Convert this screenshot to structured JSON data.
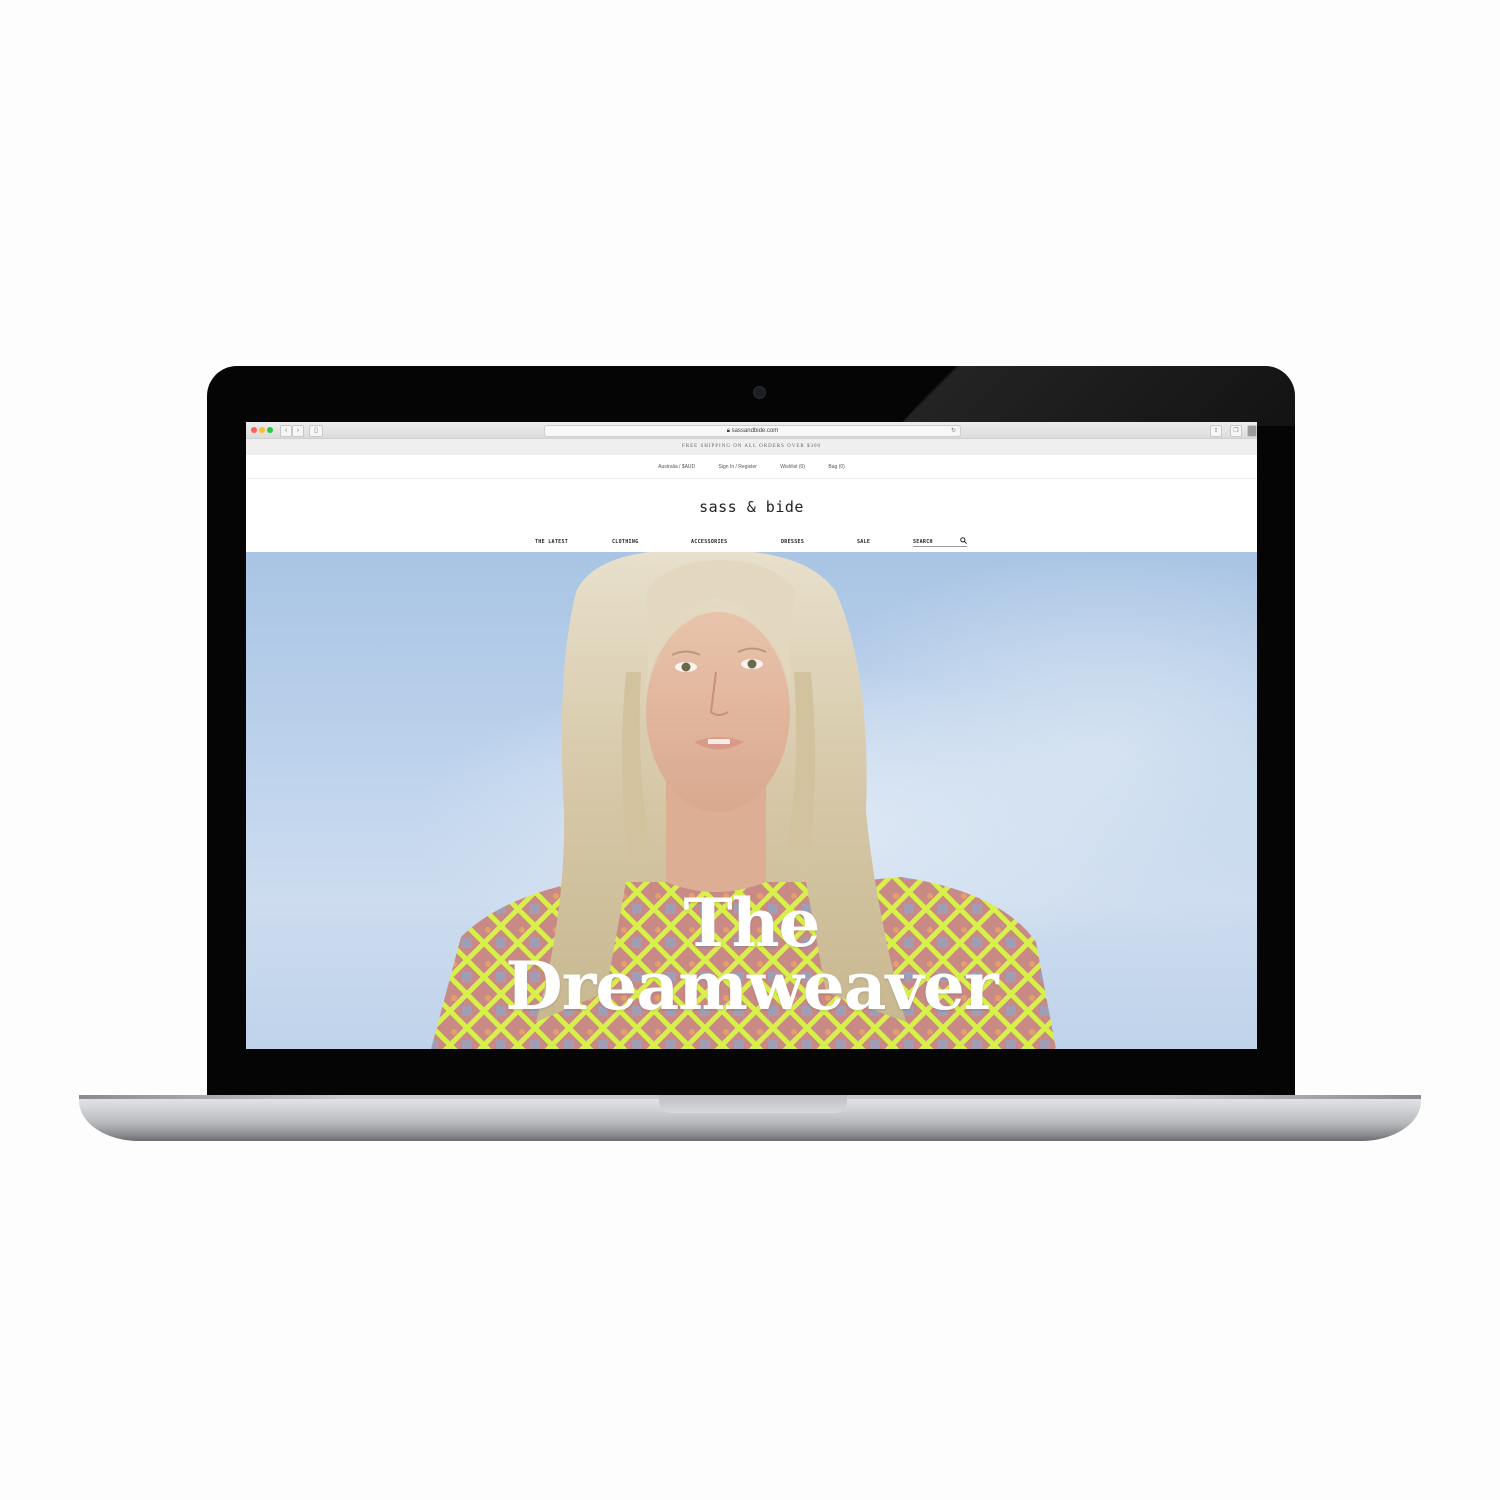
{
  "browser": {
    "url": "sassandbide.com",
    "back_icon": "chevron-left-icon",
    "forward_icon": "chevron-right-icon",
    "sidebar_icon": "sidebar-icon",
    "reload_icon": "reload-icon",
    "share_icon": "share-icon",
    "tabs_icon": "tabs-icon"
  },
  "site": {
    "promo": "FREE SHIPPING ON ALL ORDERS OVER $300",
    "utility": {
      "region": "Australia / $AUD",
      "account": "Sign In / Register",
      "wishlist": "Wishlist (0)",
      "bag": "Bag (0)"
    },
    "logo": "sass & bide",
    "nav": {
      "latest": "THE LATEST",
      "clothing": "CLOTHING",
      "accessories": "ACCESSORIES",
      "dresses": "DRESSES",
      "sale": "SALE",
      "search_label": "SEARCH"
    },
    "hero": {
      "line1": "The",
      "line2": "Dreamweaver"
    }
  },
  "colors": {
    "sky": "#bcd2ec",
    "hair": "#d8ccb0",
    "neon": "#d8f04a",
    "headline": "#ffffff"
  }
}
